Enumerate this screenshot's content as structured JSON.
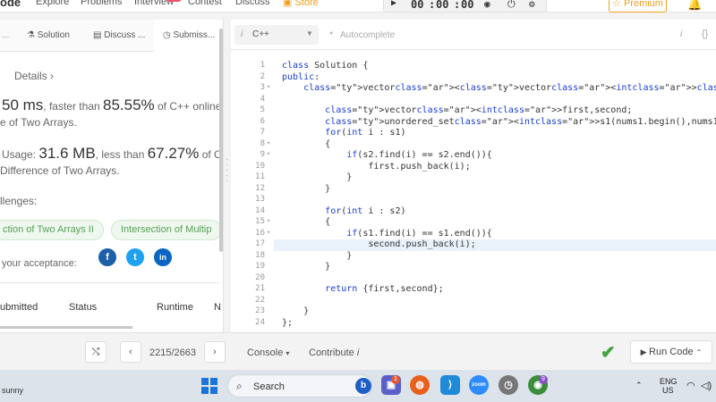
{
  "topnav": {
    "brand": "ode",
    "links": [
      "Explore",
      "Problems",
      "Interview",
      "Contest",
      "Discuss"
    ],
    "store": "Store",
    "timer": {
      "hh": "00",
      "mm": "00",
      "ss": "00"
    },
    "premium": "Premium"
  },
  "left_panel": {
    "tabs": [
      "Solution",
      "Discuss ...",
      "Submiss..."
    ],
    "details": "Details",
    "runtime": {
      "prefix": "50 ms",
      "mid": ", faster than ",
      "pct": "85.55%",
      "suffix": " of C++ online s",
      "sub": "e of Two Arrays."
    },
    "memory": {
      "prefix": "Usage: ",
      "value": "31.6 MB",
      "mid": ", less than ",
      "pct": "67.27%",
      "suffix": " of C++",
      "sub": "Difference of Two Arrays."
    },
    "challenges_label": "llenges:",
    "chips": [
      "ction of Two Arrays II",
      "Intersection of Multip"
    ],
    "share_label": "your acceptance:",
    "social": [
      "f",
      "t",
      "in"
    ],
    "table_headers": [
      "ubmitted",
      "Status",
      "Runtime",
      "N"
    ]
  },
  "editor": {
    "language": "C++",
    "autocomplete": "Autocomplete",
    "lines": [
      "class Solution {",
      "public:",
      "    vector<vector<int>> findDifference(vector<int>& nums1, vector<int>& nums2) {",
      "",
      "        vector<int>first,second;",
      "        unordered_set<int>s1(nums1.begin(),nums1.end()),s2(nums2.begin(),nums2.end",
      "        for(int i : s1)",
      "        {",
      "            if(s2.find(i) == s2.end()){",
      "                first.push_back(i);",
      "            }",
      "        }",
      "",
      "        for(int i : s2)",
      "        {",
      "            if(s1.find(i) == s1.end()){",
      "                second.push_back(i);",
      "            }",
      "        }",
      "",
      "        return {first,second};",
      "",
      "    }",
      "};"
    ]
  },
  "bottombar": {
    "page": "2215/2663",
    "console": "Console",
    "contribute": "Contribute",
    "run": "Run Code"
  },
  "taskbar": {
    "user": "sunny",
    "search": "Search",
    "lang": "ENG",
    "region": "US"
  }
}
